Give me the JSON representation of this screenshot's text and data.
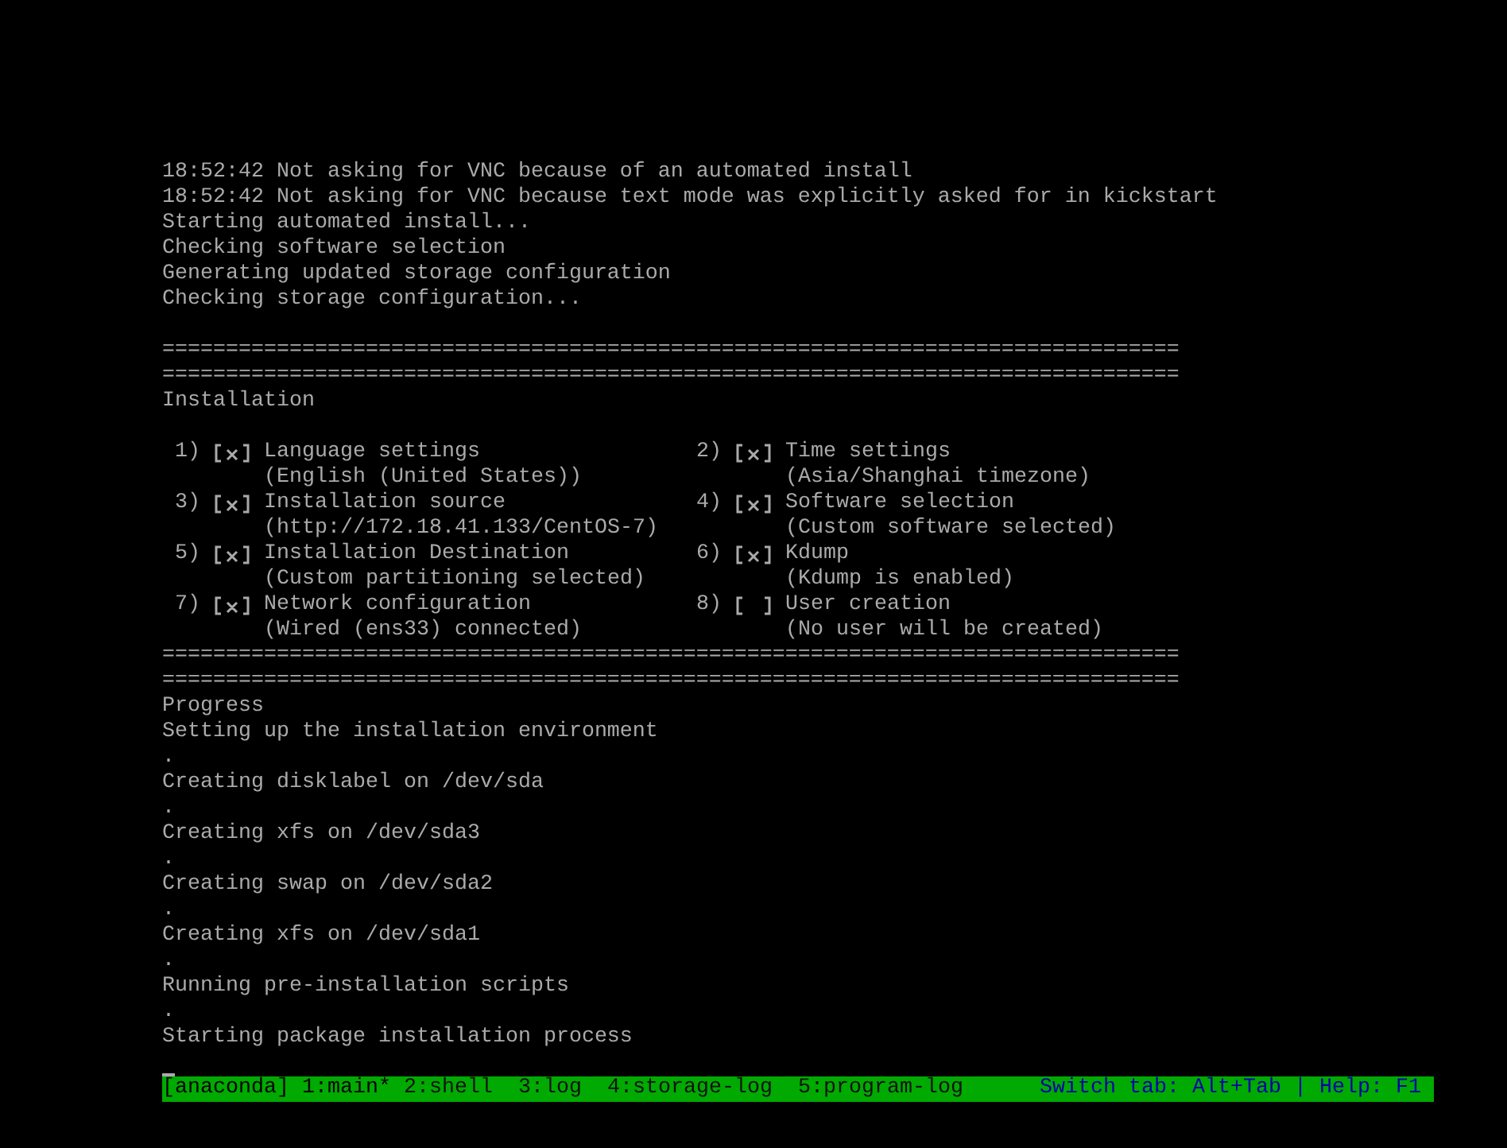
{
  "log_lines": [
    "18:52:42 Not asking for VNC because of an automated install",
    "18:52:42 Not asking for VNC because text mode was explicitly asked for in kickstart",
    "Starting automated install...",
    "Checking software selection",
    "Generating updated storage configuration",
    "Checking storage configuration..."
  ],
  "separator_top": [
    "================================================================================",
    "================================================================================"
  ],
  "hub": {
    "title": "Installation",
    "spokes": [
      {
        "number": "1)",
        "checked": true,
        "title": "Language settings",
        "status": "(English (United States))"
      },
      {
        "number": "2)",
        "checked": true,
        "title": "Time settings",
        "status": "(Asia/Shanghai timezone)"
      },
      {
        "number": "3)",
        "checked": true,
        "title": "Installation source",
        "status": "(http://172.18.41.133/CentOS-7)"
      },
      {
        "number": "4)",
        "checked": true,
        "title": "Software selection",
        "status": "(Custom software selected)"
      },
      {
        "number": "5)",
        "checked": true,
        "title": "Installation Destination",
        "status": "(Custom partitioning selected)"
      },
      {
        "number": "6)",
        "checked": true,
        "title": "Kdump",
        "status": "(Kdump is enabled)"
      },
      {
        "number": "7)",
        "checked": true,
        "title": "Network configuration",
        "status": "(Wired (ens33) connected)"
      },
      {
        "number": "8)",
        "checked": false,
        "title": "User creation",
        "status": "(No user will be created)"
      }
    ]
  },
  "separator_bottom": [
    "================================================================================",
    "================================================================================"
  ],
  "progress": {
    "title": "Progress",
    "lines": [
      "Setting up the installation environment",
      ".",
      "Creating disklabel on /dev/sda",
      ".",
      "Creating xfs on /dev/sda3",
      ".",
      "Creating swap on /dev/sda2",
      ".",
      "Creating xfs on /dev/sda1",
      ".",
      "Running pre-installation scripts",
      ".",
      "Starting package installation process"
    ]
  },
  "status_bar": {
    "session": "[anaconda]",
    "tabs": [
      {
        "label": "1:main*",
        "selected": true
      },
      {
        "label": "2:shell",
        "selected": false
      },
      {
        "label": "3:log",
        "selected": false
      },
      {
        "label": "4:storage-log",
        "selected": false
      },
      {
        "label": "5:program-log",
        "selected": false
      }
    ],
    "hint": "Switch tab: Alt+Tab | Help: F1"
  }
}
